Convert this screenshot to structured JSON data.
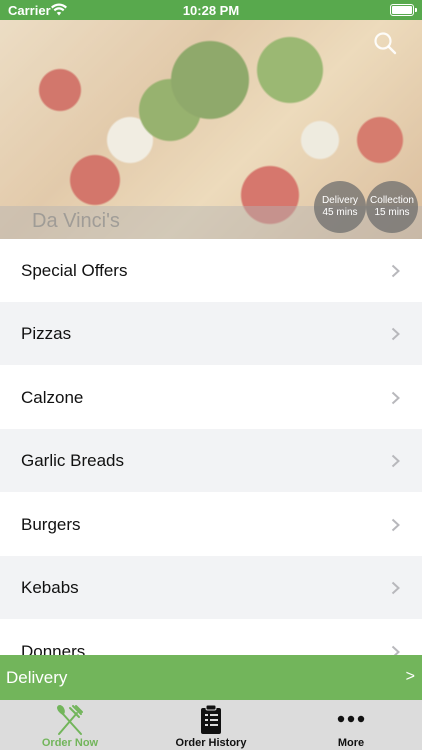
{
  "status_bar": {
    "carrier": "Carrier",
    "time": "10:28 PM"
  },
  "hero": {
    "restaurant_name": "Da Vinci's",
    "delivery_badge": {
      "line1": "Delivery",
      "line2": "45 mins"
    },
    "collection_badge": {
      "line1": "Collection",
      "line2": "15 mins"
    }
  },
  "categories": [
    {
      "label": "Special Offers"
    },
    {
      "label": "Pizzas"
    },
    {
      "label": "Calzone"
    },
    {
      "label": "Garlic Breads"
    },
    {
      "label": "Burgers"
    },
    {
      "label": "Kebabs"
    },
    {
      "label": "Donners"
    }
  ],
  "order_bar": {
    "label": "Delivery",
    "arrow": ">"
  },
  "tabs": [
    {
      "label": "Order Now",
      "icon": "fork-knife-icon",
      "active": true
    },
    {
      "label": "Order History",
      "icon": "receipt-icon",
      "active": false
    },
    {
      "label": "More",
      "icon": "more-dots-icon",
      "active": false
    }
  ],
  "colors": {
    "accent": "#72b55b",
    "status_bar": "#58a94d",
    "tab_bar": "#dcdcdc",
    "row_alt": "#f2f3f5"
  }
}
